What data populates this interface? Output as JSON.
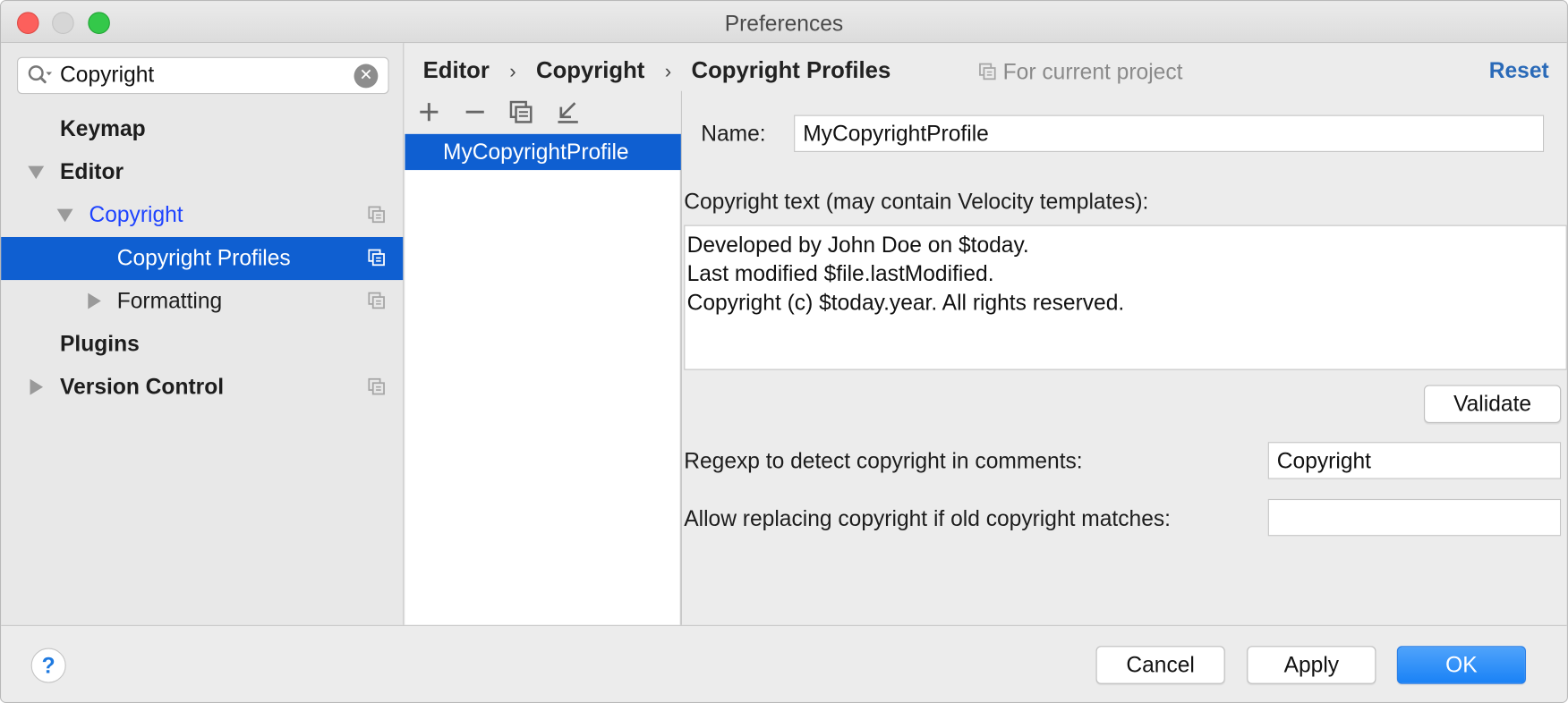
{
  "window": {
    "title": "Preferences"
  },
  "search": {
    "value": "Copyright",
    "clear_icon": "clear-icon"
  },
  "sidebar": {
    "items": [
      {
        "label": "Keymap"
      },
      {
        "label": "Editor"
      },
      {
        "label": "Copyright"
      },
      {
        "label": "Copyright Profiles"
      },
      {
        "label": "Formatting"
      },
      {
        "label": "Plugins"
      },
      {
        "label": "Version Control"
      }
    ]
  },
  "breadcrumb": {
    "items": [
      "Editor",
      "Copyright",
      "Copyright Profiles"
    ],
    "separator": "›"
  },
  "scope": {
    "label": "For current project"
  },
  "reset_label": "Reset",
  "profiles": {
    "items": [
      "MyCopyrightProfile"
    ]
  },
  "form": {
    "name_label": "Name:",
    "name_value": "MyCopyrightProfile",
    "text_label": "Copyright text (may contain Velocity templates):",
    "text_value": "Developed by John Doe on $today.\nLast modified $file.lastModified.\nCopyright (c) $today.year. All rights reserved.",
    "validate_label": "Validate",
    "regexp_label": "Regexp to detect copyright in comments:",
    "regexp_value": "Copyright",
    "replace_label": "Allow replacing copyright if old copyright matches:",
    "replace_value": ""
  },
  "footer": {
    "help_label": "?",
    "cancel_label": "Cancel",
    "apply_label": "Apply",
    "ok_label": "OK"
  },
  "colors": {
    "selection": "#0f5fd1",
    "link": "#2a6ab8",
    "primary_button": "#1a82f6"
  }
}
